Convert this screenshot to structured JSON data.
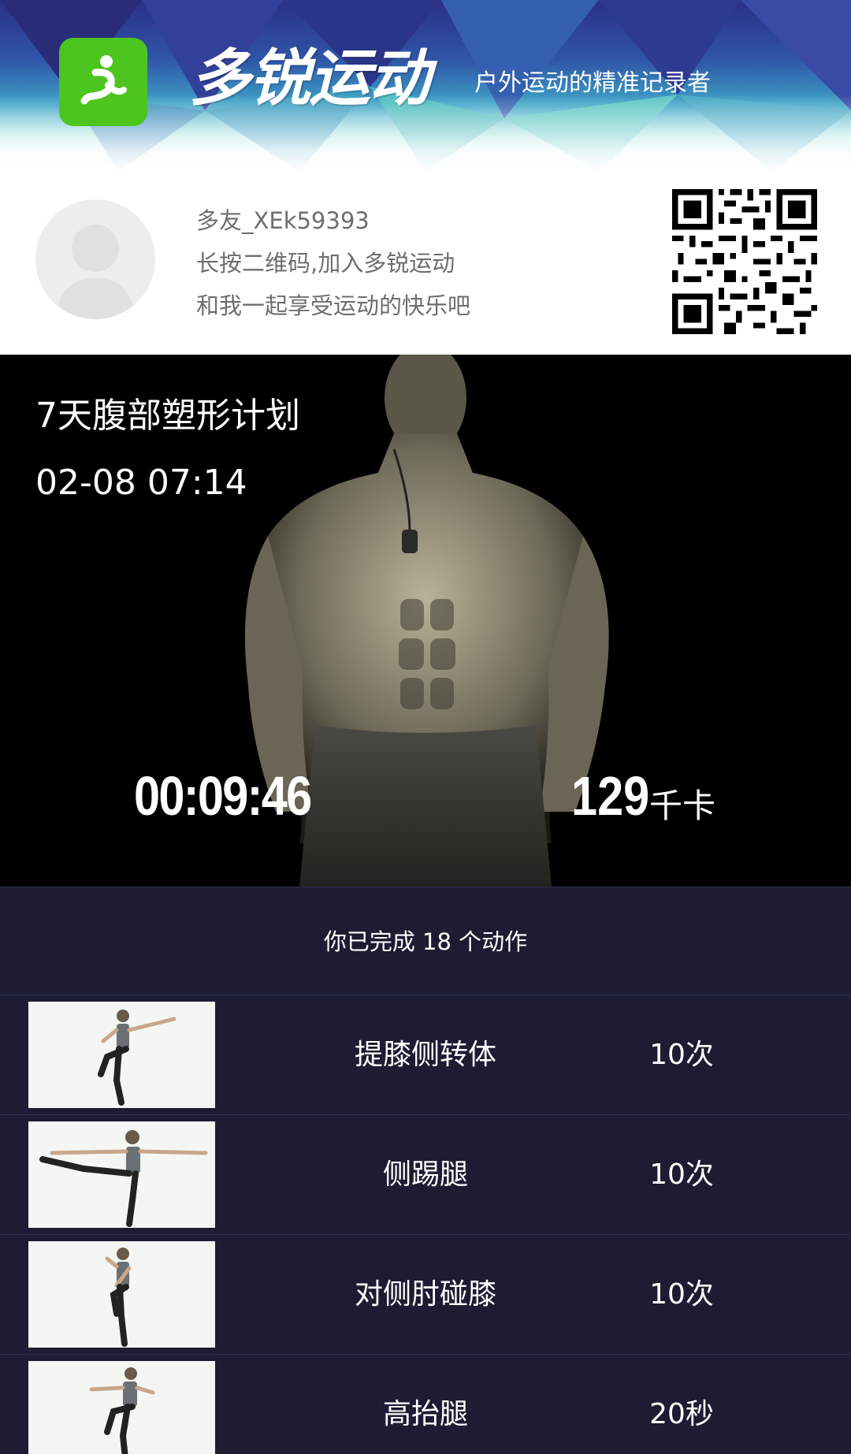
{
  "header": {
    "brand_name": "多锐运动",
    "slogan": "户外运动的精准记录者",
    "logo_icon": "runner-logo-icon",
    "accent_color": "#4cc51e"
  },
  "profile": {
    "username": "多友_XEk59393",
    "line1": "长按二维码,加入多锐运动",
    "line2": "和我一起享受运动的快乐吧",
    "avatar_icon": "default-avatar-icon",
    "qr_icon": "qr-code-icon"
  },
  "workout": {
    "plan_title": "7天腹部塑形计划",
    "datetime": "02-08 07:14",
    "duration": "00:09:46",
    "calories": "129",
    "calories_unit": "千卡"
  },
  "summary": {
    "text": "你已完成 18 个动作"
  },
  "exercises": [
    {
      "name": "提膝侧转体",
      "count": "10次"
    },
    {
      "name": "侧踢腿",
      "count": "10次"
    },
    {
      "name": "对侧肘碰膝",
      "count": "10次"
    },
    {
      "name": "高抬腿",
      "count": "20秒"
    }
  ]
}
